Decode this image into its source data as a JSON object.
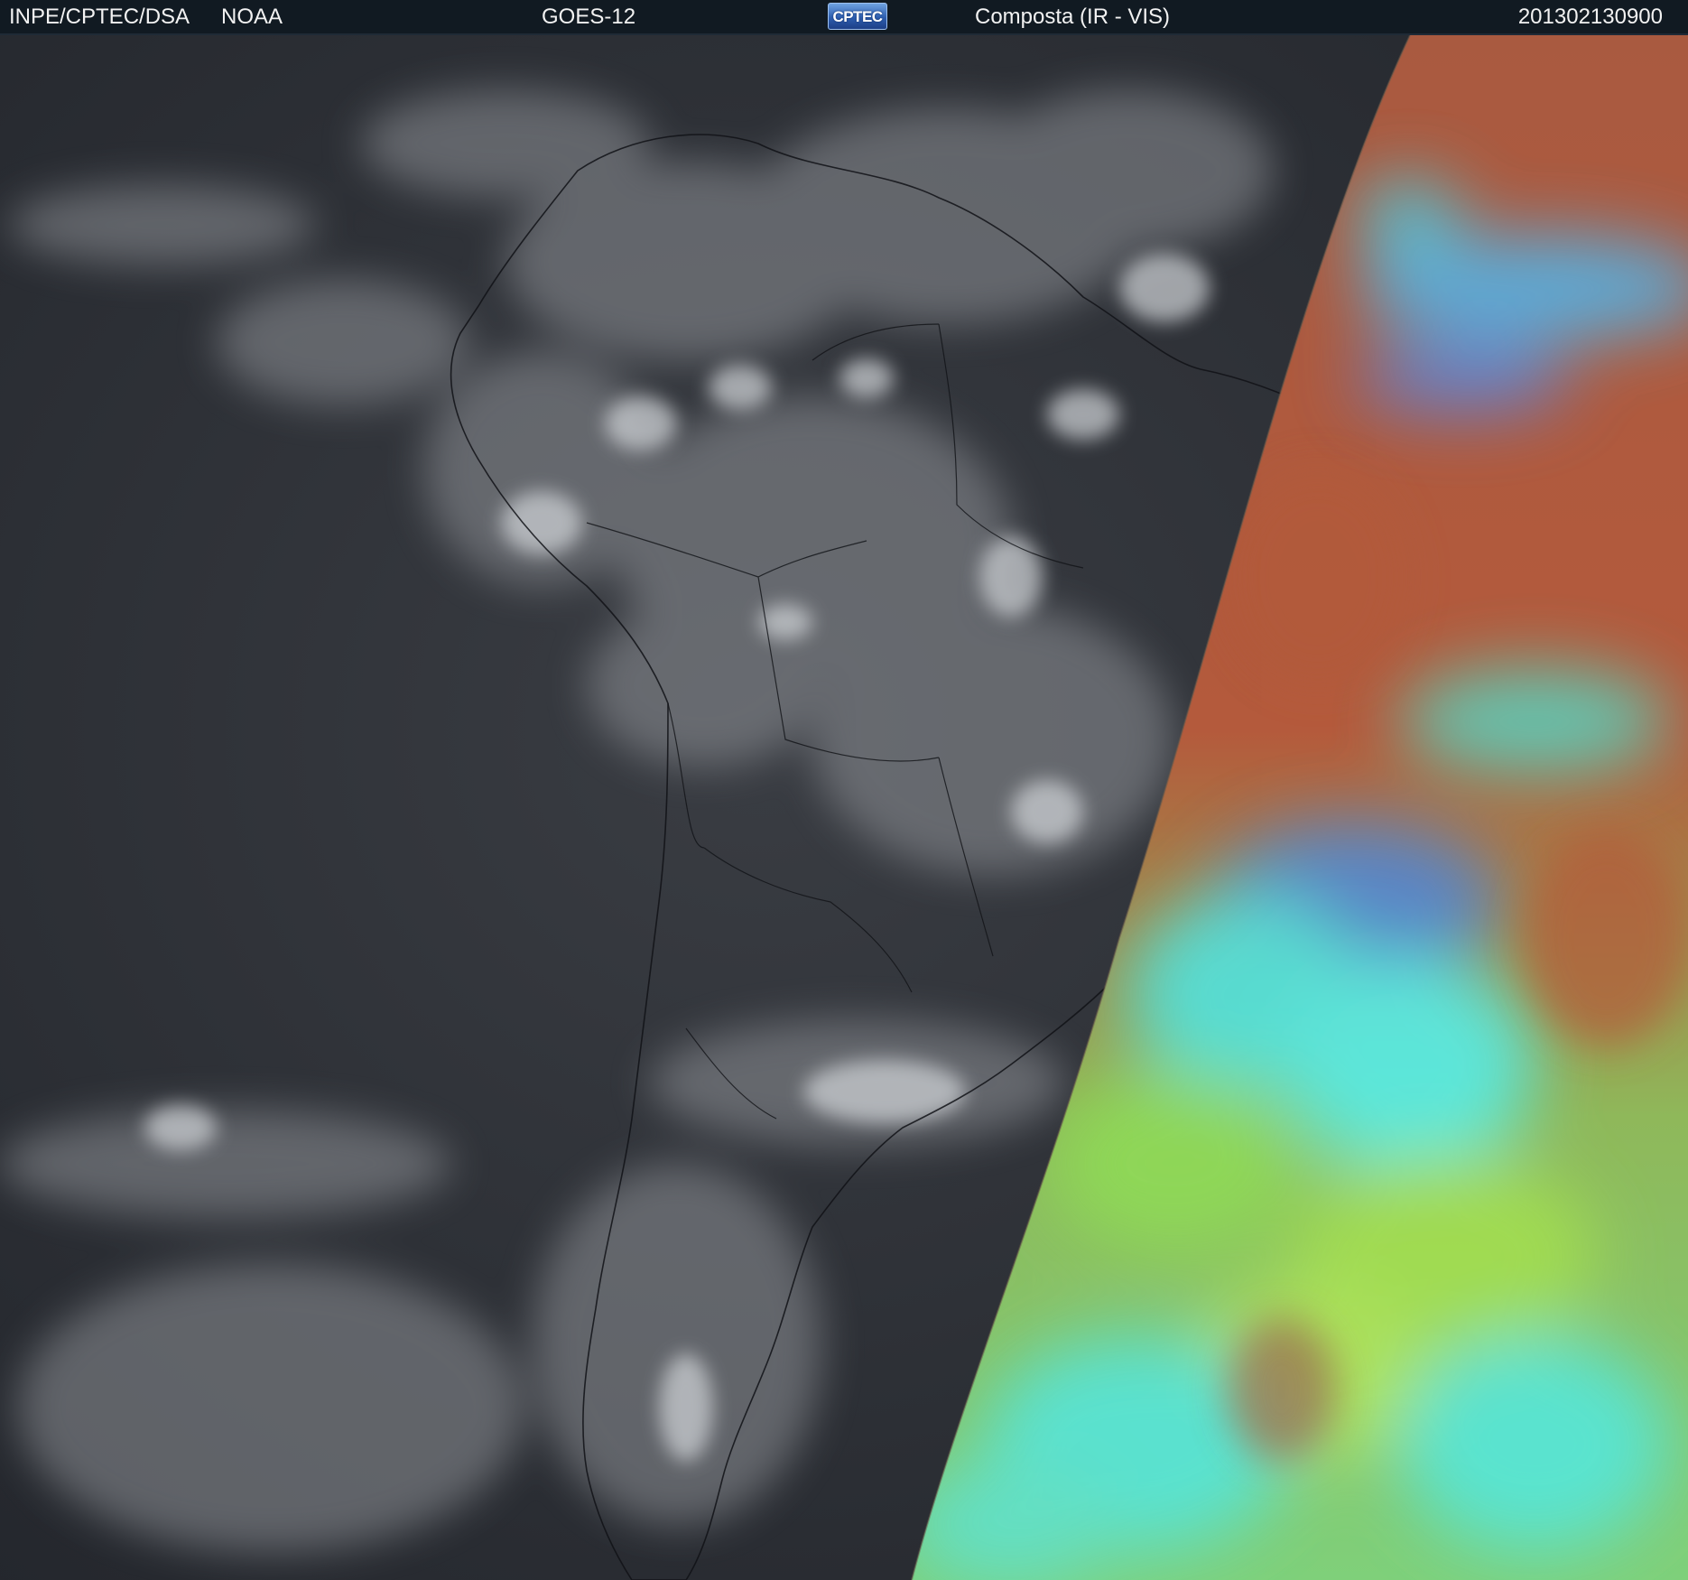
{
  "header": {
    "source": "INPE/CPTEC/DSA",
    "agency": "NOAA",
    "satellite": "GOES-12",
    "logo_text": "CPTEC",
    "product": "Composta (IR - VIS)",
    "timestamp": "201302130900"
  },
  "colors": {
    "header_bg": "#111a22",
    "ir_dark": "#2a2d33",
    "ir_cloud": "#cfd2d6",
    "vis_red": "#b85a3a",
    "vis_green": "#9bd84e",
    "vis_cyan": "#4fe8e8",
    "vis_blue": "#4a7ad8"
  }
}
